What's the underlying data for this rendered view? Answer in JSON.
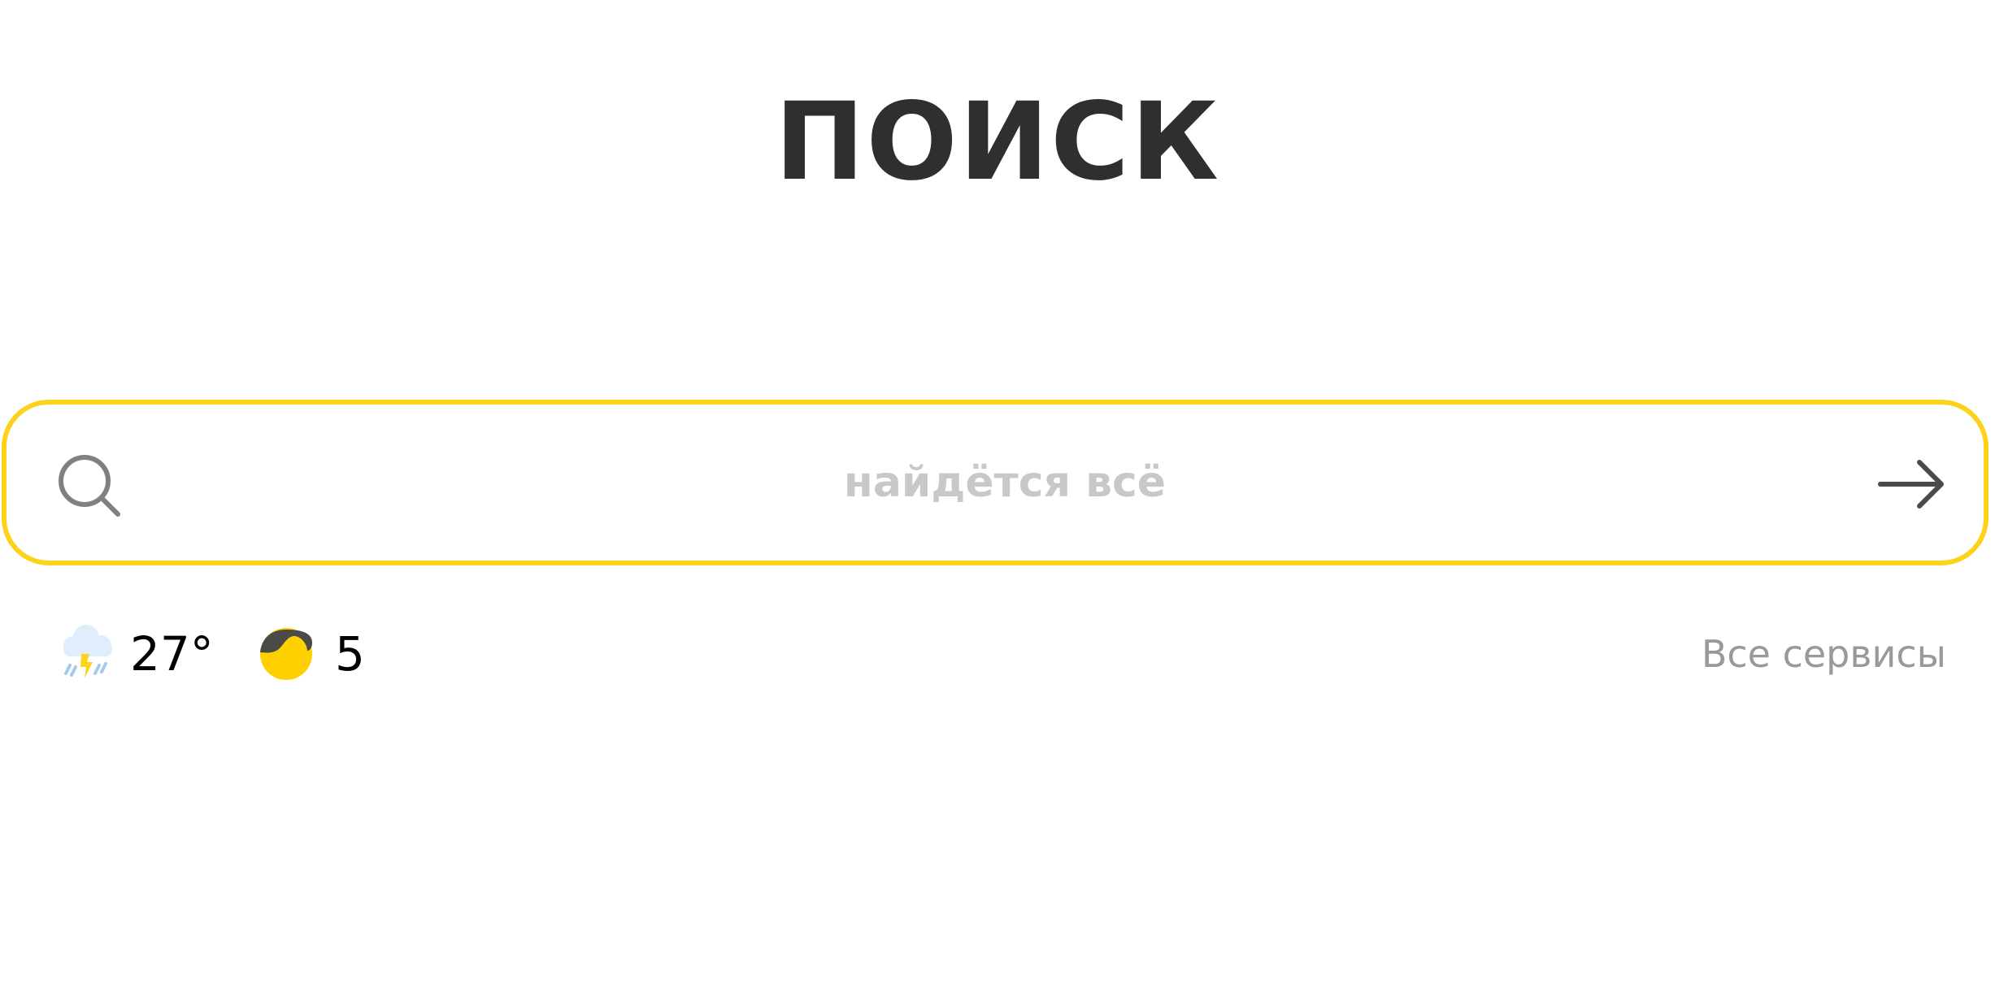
{
  "logo": {
    "text": "ПОИСК"
  },
  "search": {
    "placeholder": "найдётся всё",
    "value": ""
  },
  "weather": {
    "icon": "thunderstorm-icon",
    "temperature": "27°"
  },
  "traffic": {
    "icon": "traffic-level-icon",
    "score": "5"
  },
  "services": {
    "label": "Все сервисы"
  },
  "colors": {
    "accent": "#fdd21c",
    "logo": "#2f2f2d",
    "placeholder": "#c8c8c8",
    "muted_link": "#999999"
  }
}
